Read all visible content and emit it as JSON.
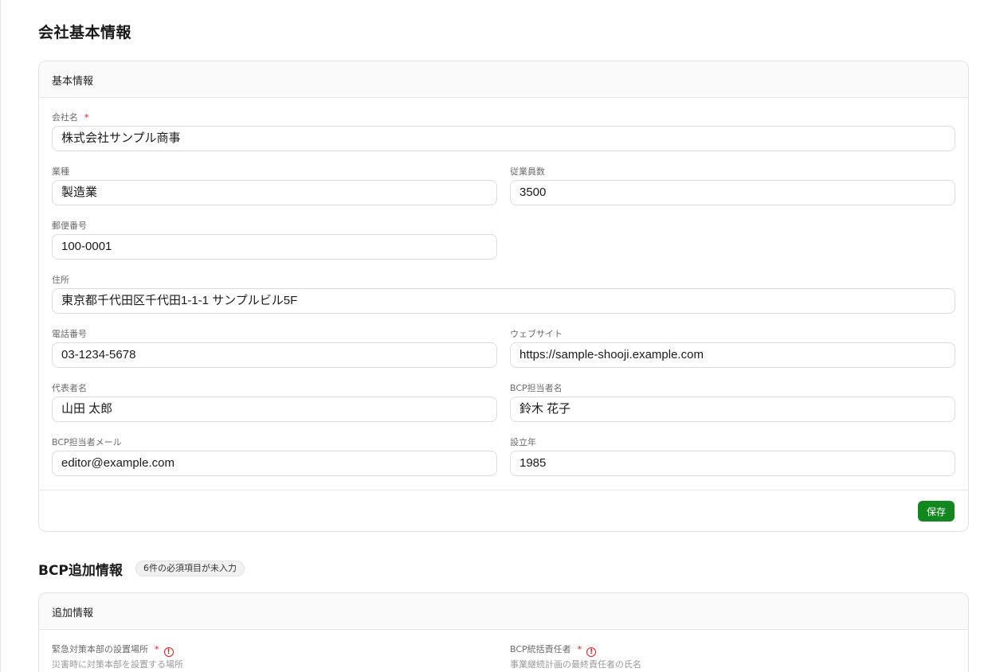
{
  "page": {
    "title": "会社基本情報"
  },
  "basic": {
    "header": "基本情報",
    "company_name": {
      "label": "会社名",
      "required": "*",
      "value": "株式会社サンプル商事"
    },
    "industry": {
      "label": "業種",
      "value": "製造業"
    },
    "employees": {
      "label": "従業員数",
      "value": "3500"
    },
    "postal": {
      "label": "郵便番号",
      "value": "100-0001"
    },
    "address": {
      "label": "住所",
      "value": "東京都千代田区千代田1-1-1 サンプルビル5F"
    },
    "phone": {
      "label": "電話番号",
      "value": "03-1234-5678"
    },
    "website": {
      "label": "ウェブサイト",
      "value": "https://sample-shooji.example.com"
    },
    "representative": {
      "label": "代表者名",
      "value": "山田 太郎"
    },
    "bcp_contact": {
      "label": "BCP担当者名",
      "value": "鈴木 花子"
    },
    "bcp_email": {
      "label": "BCP担当者メール",
      "value": "editor@example.com"
    },
    "founded": {
      "label": "設立年",
      "value": "1985"
    },
    "save_label": "保存"
  },
  "bcp": {
    "title": "BCP追加情報",
    "badge": "6件の必須項目が未入力",
    "header": "追加情報",
    "hq_location": {
      "label": "緊急対策本部の設置場所",
      "required": "*",
      "hint": "災害時に対策本部を設置する場所"
    },
    "bcp_manager": {
      "label": "BCP統括責任者",
      "required": "*",
      "hint": "事業継続計画の最終責任者の氏名"
    }
  },
  "colors": {
    "primary": "#12861f",
    "required": "#d92020",
    "border": "#e3e3e3"
  },
  "icons": {
    "warning": "alert-circle-icon"
  }
}
